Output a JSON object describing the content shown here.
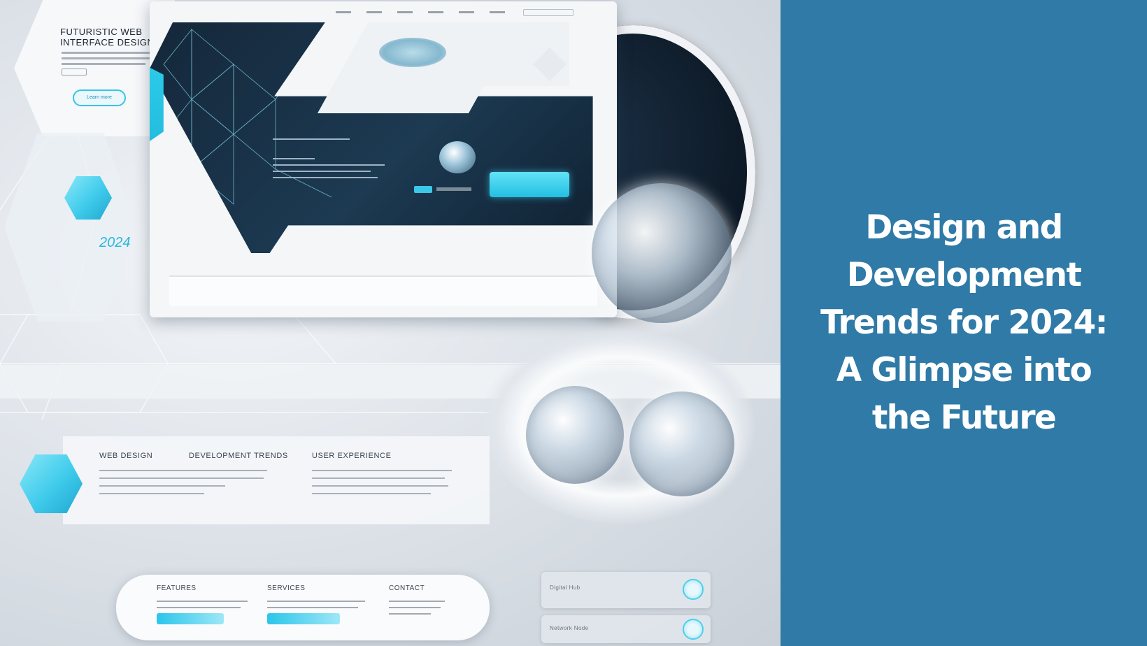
{
  "title": {
    "lines": [
      "Design and",
      "Development",
      "Trends for 2024:",
      "A Glimpse into",
      "the Future"
    ],
    "color": "#ffffff",
    "background": "#2f7aa7"
  },
  "illustration": {
    "card_heading": "FUTURISTIC WEB\nINTERFACE DESIGN",
    "card_button": "Learn more",
    "ghost_number": "2024",
    "section_headings": [
      "WEB DESIGN",
      "DEVELOPMENT TRENDS",
      "USER EXPERIENCE"
    ],
    "pill_headings": [
      "FEATURES",
      "SERVICES",
      "CONTACT"
    ],
    "widget_labels": [
      "Digital Hub",
      "Network Node"
    ],
    "accent_cyan": "#35c5e6",
    "panel_dark": "#15273a"
  }
}
